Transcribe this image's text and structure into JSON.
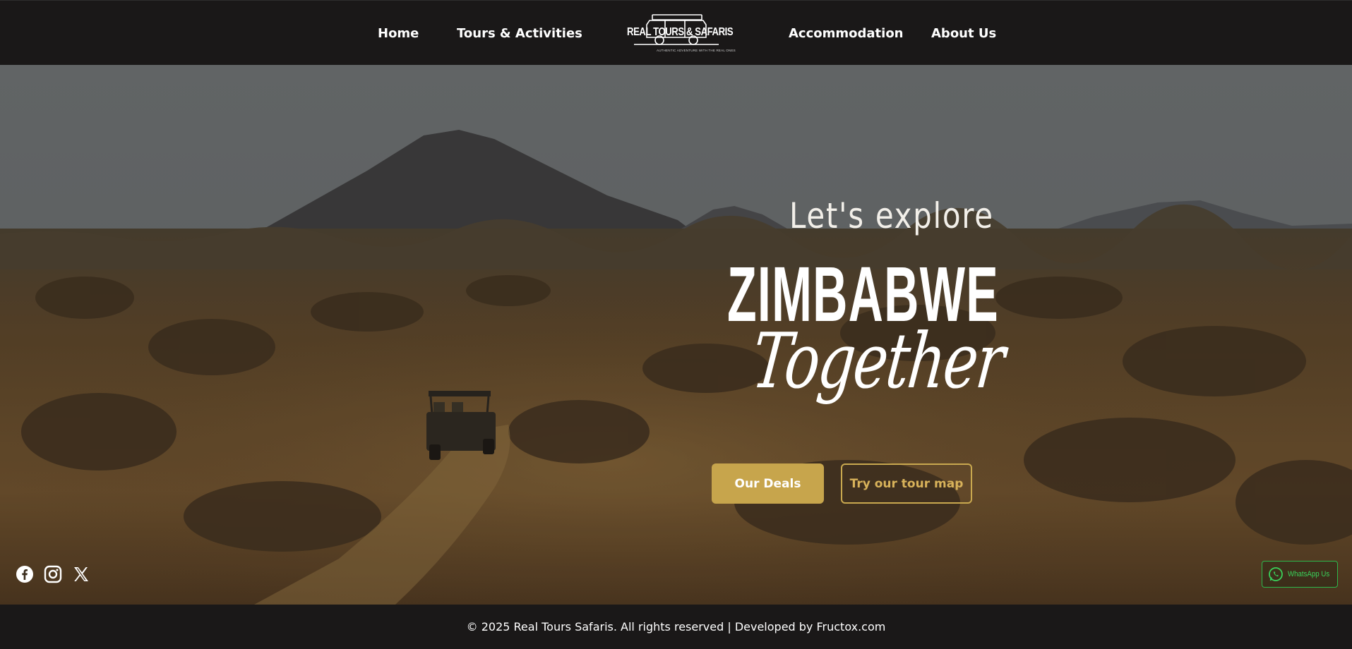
{
  "nav": {
    "home": "Home",
    "tours": "Tours & Activities",
    "accommodation": "Accommodation",
    "about": "About Us"
  },
  "logo": {
    "name": "REAL TOURS & SAFARIS",
    "tagline": "AUTHENTIC ADVENTURE WITH THE REAL ONES"
  },
  "hero": {
    "pre_title": "Let's explore",
    "title": "ZIMBABWE",
    "script": "Together",
    "primary_button": "Our Deals",
    "secondary_button": "Try our tour map"
  },
  "social": {
    "icons": [
      "facebook-icon",
      "instagram-icon",
      "x-icon"
    ]
  },
  "whatsapp": {
    "label": "WhatsApp Us"
  },
  "footer": {
    "text": "© 2025 Real Tours Safaris. All rights reserved | Developed by Fructox.com"
  },
  "colors": {
    "header_bg": "#1a1818",
    "accent_gold": "#c7a54c",
    "whatsapp_green": "#2db84c",
    "text_white": "#ffffff"
  }
}
